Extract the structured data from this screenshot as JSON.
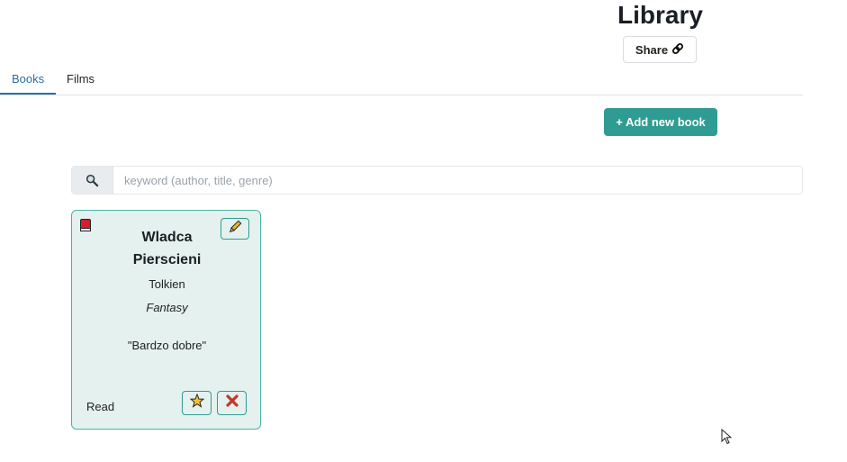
{
  "header": {
    "title": "Library",
    "share_label": "Share"
  },
  "tabs": [
    {
      "label": "Books",
      "active": true
    },
    {
      "label": "Films",
      "active": false
    }
  ],
  "toolbar": {
    "add_label": "+ Add new book"
  },
  "search": {
    "placeholder": "keyword (author, title, genre)",
    "value": ""
  },
  "books": [
    {
      "title_line1": "Wladca",
      "title_line2": "Pierscieni",
      "author": "Tolkien",
      "genre": "Fantasy",
      "review": "\"Bardzo dobre\"",
      "status": "Read",
      "icon": "book-icon"
    }
  ],
  "colors": {
    "accent": "#2f9c93",
    "card_bg": "#e4f1ee",
    "card_border": "#4bb3a6",
    "tab_active": "#2e6ea6",
    "book_icon": "#d0202e",
    "star": "#f2c230",
    "delete": "#c0392b"
  }
}
